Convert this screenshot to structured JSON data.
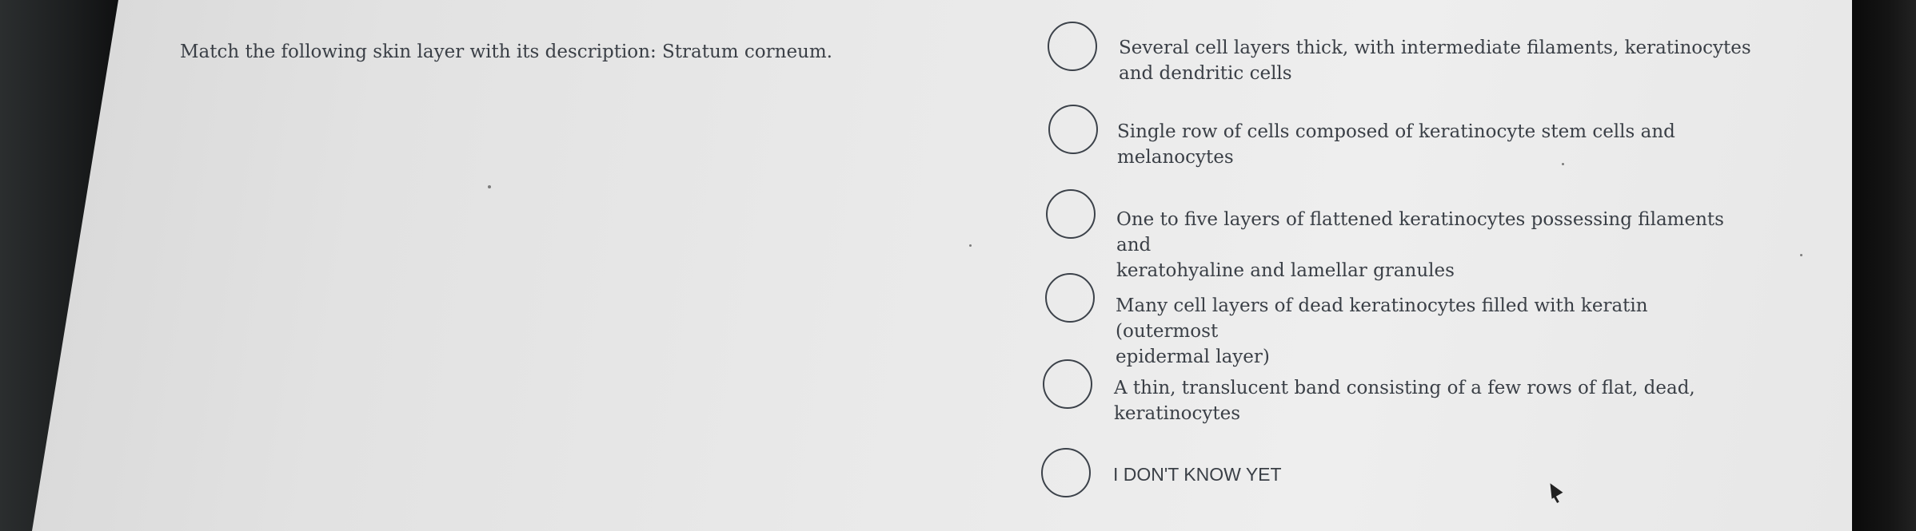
{
  "question": {
    "text": "Match the following skin layer with its description: Stratum corneum."
  },
  "options": [
    {
      "line1": "Several cell layers thick, with intermediate filaments, keratinocytes",
      "line2": "and dendritic cells",
      "selected": false
    },
    {
      "line1": "Single row of cells composed of keratinocyte stem cells and",
      "line2": "melanocytes",
      "selected": false
    },
    {
      "line1": "One to five layers of flattened keratinocytes possessing filaments and",
      "line2": "keratohyaline and lamellar granules",
      "selected": false
    },
    {
      "line1": "Many cell layers of dead keratinocytes filled with keratin (outermost",
      "line2": "epidermal layer)",
      "selected": false
    },
    {
      "line1": "A thin, translucent band consisting of a few rows of flat, dead,",
      "line2": "keratinocytes",
      "selected": false
    },
    {
      "line1": "I DON'T KNOW YET",
      "line2": "",
      "selected": false
    }
  ]
}
